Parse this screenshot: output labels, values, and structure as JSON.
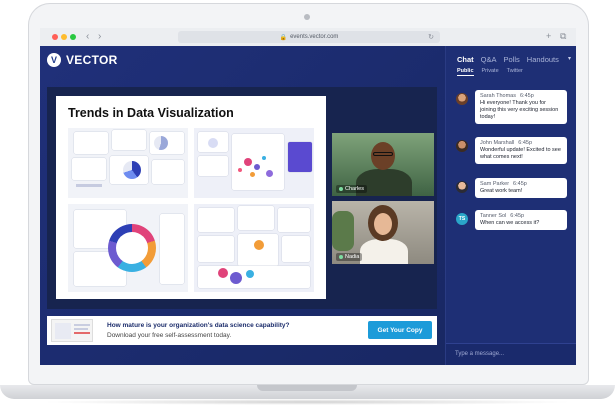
{
  "browser": {
    "url": "events.vector.com",
    "nav_back": "‹",
    "nav_forward": "›",
    "reload": "↻",
    "new_tab": "+",
    "window_icon": "⧉"
  },
  "app": {
    "logo_mark": "V",
    "logo_text": "VECTOR"
  },
  "slide": {
    "title": "Trends in Data Visualization"
  },
  "videos": [
    {
      "name": "Charles"
    },
    {
      "name": "Nadia"
    }
  ],
  "banner": {
    "question": "How mature is your organization's data science capability?",
    "subtitle": "Download your free self-assessment today.",
    "cta": "Get Your Copy"
  },
  "chat": {
    "tabs": [
      "Chat",
      "Q&A",
      "Polls",
      "Handouts"
    ],
    "caret": "▾",
    "subtabs": [
      "Public",
      "Private",
      "Twitter"
    ],
    "messages": [
      {
        "name": "Sarah Thomas",
        "time": "6:45p",
        "text": "Hi everyone! Thank you for joining this very exciting session today!"
      },
      {
        "name": "John Marshall",
        "time": "6:45p",
        "text": "Wonderful update! Excited to see what comes next!"
      },
      {
        "name": "Sam Parker",
        "time": "6:45p",
        "text": "Great work team!"
      },
      {
        "name": "Tanner Sol",
        "time": "6:45p",
        "text": "When can we access it?",
        "initials": "TS"
      }
    ],
    "input_placeholder": "Type a message..."
  },
  "colors": {
    "app_bg": "#1b2c6b",
    "cta": "#1c9bd9",
    "accent_purple": "#6d5bd0"
  }
}
